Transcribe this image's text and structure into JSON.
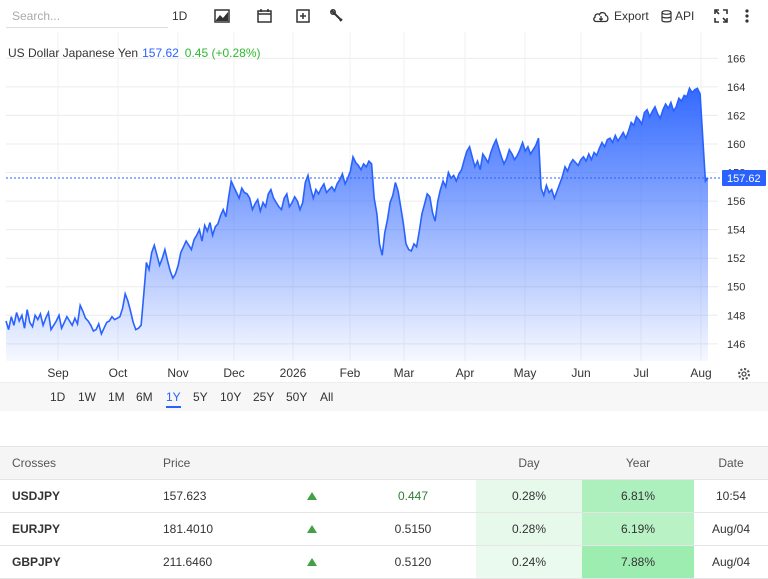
{
  "toolbar": {
    "search_placeholder": "Search...",
    "interval_label": "1D",
    "export_label": "Export",
    "api_label": "API"
  },
  "chart": {
    "title": "US Dollar Japanese Yen",
    "last_price": "157.62",
    "change": "0.45 (+0.28%)",
    "price_tag": "157.62",
    "accent_color": "#2962ff",
    "up_color": "#2eb82e"
  },
  "chart_data": {
    "type": "area",
    "title": "US Dollar Japanese Yen",
    "x_months": [
      "Sep",
      "Oct",
      "Nov",
      "Dec",
      "2026",
      "Feb",
      "Mar",
      "Apr",
      "May",
      "Jun",
      "Jul",
      "Aug"
    ],
    "y_ticks": [
      146,
      148,
      150,
      152,
      154,
      156,
      158,
      160,
      162,
      164,
      166
    ],
    "ylim": [
      144.8,
      167
    ],
    "last_value": 157.62,
    "series": [
      {
        "values": [
          147.6,
          147.0,
          147.9,
          147.3,
          148.2,
          147.6,
          148.0,
          147.1,
          148.4,
          147.5,
          147.2,
          148.0,
          147.7,
          148.1,
          147.3,
          147.8,
          148.2,
          147.0,
          147.3,
          147.6,
          148.0,
          147.1,
          147.5,
          147.9,
          147.6,
          147.3,
          147.8,
          147.4,
          148.7,
          148.3,
          147.8,
          147.6,
          147.3,
          146.9,
          147.0,
          147.4,
          146.7,
          147.1,
          147.5,
          147.6,
          147.9,
          147.7,
          147.8,
          147.9,
          148.5,
          149.5,
          149.0,
          148.3,
          147.5,
          147.0,
          147.1,
          147.3,
          149.5,
          151.7,
          151.2,
          152.4,
          152.9,
          152.2,
          151.5,
          152.0,
          152.6,
          151.8,
          151.1,
          150.6,
          150.9,
          151.5,
          152.4,
          152.8,
          153.2,
          152.9,
          152.6,
          153.3,
          153.6,
          154.0,
          153.2,
          154.3,
          153.9,
          154.5,
          153.6,
          154.2,
          154.4,
          155.0,
          155.4,
          154.9,
          156.2,
          157.4,
          157.0,
          156.6,
          156.2,
          156.9,
          156.6,
          156.5,
          156.2,
          155.4,
          155.8,
          156.1,
          155.3,
          155.9,
          155.6,
          156.5,
          156.8,
          156.2,
          155.9,
          155.6,
          155.4,
          156.2,
          156.5,
          155.6,
          155.9,
          156.3,
          156.0,
          155.4,
          155.9,
          157.3,
          157.8,
          156.9,
          156.2,
          156.8,
          156.5,
          156.9,
          157.2,
          156.6,
          156.8,
          157.0,
          156.7,
          157.2,
          157.5,
          157.9,
          157.2,
          157.6,
          158.1,
          159.1,
          158.7,
          158.5,
          158.2,
          158.6,
          158.4,
          158.8,
          158.6,
          156.2,
          155.1,
          153.0,
          152.2,
          153.8,
          154.7,
          155.9,
          156.4,
          157.3,
          156.7,
          155.6,
          154.4,
          153.0,
          152.6,
          152.5,
          153.0,
          152.8,
          153.9,
          155.1,
          155.8,
          156.5,
          156.3,
          155.2,
          154.6,
          156.0,
          156.8,
          157.4,
          157.0,
          158.0,
          157.6,
          157.8,
          157.4,
          157.9,
          158.2,
          158.9,
          159.5,
          159.8,
          159.1,
          158.4,
          158.8,
          158.2,
          159.3,
          159.0,
          158.7,
          159.4,
          159.9,
          160.3,
          159.7,
          159.1,
          158.6,
          159.0,
          159.6,
          159.3,
          158.9,
          159.2,
          159.6,
          160.1,
          159.5,
          159.8,
          159.3,
          159.6,
          159.9,
          160.4,
          156.9,
          156.4,
          157.1,
          156.6,
          156.8,
          156.2,
          156.7,
          157.2,
          157.7,
          158.4,
          158.1,
          158.6,
          158.9,
          158.7,
          158.5,
          158.9,
          159.1,
          158.8,
          159.3,
          158.9,
          159.4,
          159.2,
          159.7,
          160.1,
          159.8,
          160.3,
          160.4,
          160.1,
          160.6,
          160.2,
          160.5,
          160.8,
          160.4,
          160.9,
          161.5,
          161.3,
          161.9,
          161.7,
          161.4,
          162.2,
          162.4,
          161.9,
          162.3,
          162.6,
          162.1,
          161.8,
          162.4,
          162.8,
          162.5,
          162.9,
          162.3,
          162.6,
          163.2,
          163.0,
          163.4,
          163.3,
          163.9,
          163.6,
          163.8,
          163.9,
          163.5,
          160.5,
          157.4,
          157.62
        ]
      }
    ]
  },
  "range_buttons": [
    "1D",
    "1W",
    "1M",
    "6M",
    "1Y",
    "5Y",
    "10Y",
    "25Y",
    "50Y",
    "All"
  ],
  "range_active": "1Y",
  "table": {
    "headers": [
      "Crosses",
      "Price",
      "Day",
      "Year",
      "Date"
    ],
    "rows": [
      {
        "symbol": "USDJPY",
        "price": "157.623",
        "change": "0.447",
        "day": "0.28%",
        "year": "6.81%",
        "date": "10:54"
      },
      {
        "symbol": "EURJPY",
        "price": "181.4010",
        "change": "0.5150",
        "day": "0.28%",
        "year": "6.19%",
        "date": "Aug/04"
      },
      {
        "symbol": "GBPJPY",
        "price": "211.6460",
        "change": "0.5120",
        "day": "0.24%",
        "year": "7.88%",
        "date": "Aug/04"
      }
    ]
  }
}
